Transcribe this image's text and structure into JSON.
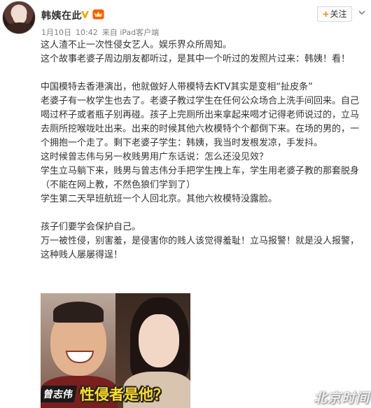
{
  "post": {
    "username": "韩姨在此",
    "follow_label": "关注",
    "meta": {
      "date": "1月10日",
      "time": "10:42",
      "source": "来自 iPad客户端"
    },
    "paragraphs": [
      [
        "这人渣不止一次性侵女艺人。娱乐界众所周知。",
        "这个故事老婆子周边朋友都听过，是其中一个听过的发照片过来：韩姨！看！"
      ],
      [
        "中国模特去香港演出，他就做好人带模特去KTV其实是变相“扯皮条”",
        "老婆子有一枚学生也去了。老婆子教过学生在任何公众场合上洗手间回来。自己",
        "喝过杯子或者瓶子别再碰。孩子上完厕所出来拿起来喝才记得老师说过的，立马",
        "去厕所挖喉咙吐出来。出来的时候其他六枚模特个个都倒下来。在场的男的，一",
        "个拥抱一个走了。剩下老婆子学生：韩姨，我当时发根发凉，手发抖。",
        "这时候曾志伟与另一枚贱男用广东话说：怎么还没见效？",
        "学生立马躺下来，贱男与曾志伟分手把学生拽上车，学生用老婆子教的那套脱身",
        "（不能在网上教，不然色狼们学到了）",
        "学生第二天早班航班一个人回北京。其他六枚模特没露脸。"
      ],
      [
        "孩子们要学会保护自己。",
        "万一被性侵，别害羞，是侵害你的贱人该觉得羞耻！立马报警！就是没人报警，",
        "这种贱人屡屡得逞！"
      ]
    ],
    "image": {
      "caption_name": "曾志伟",
      "caption_quote": "性侵者是他？"
    },
    "watermark": "北京时间"
  },
  "colors": {
    "accent": "#ff8200",
    "meta_text": "#808080",
    "body_text": "#333333",
    "caption_quote": "#ffdd22"
  },
  "icons": [
    "verified-v-icon",
    "member-crown-icon",
    "chevron-down-icon"
  ]
}
